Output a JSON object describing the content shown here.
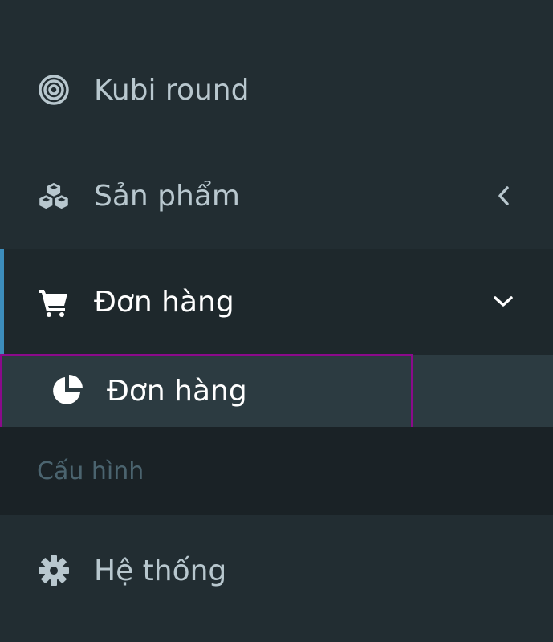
{
  "sidebar": {
    "items": [
      {
        "label": "Kubi round",
        "icon": "bullseye-icon"
      },
      {
        "label": "Sản phẩm",
        "icon": "cubes-icon",
        "chevron": "chevron-left-icon"
      },
      {
        "label": "Đơn hàng",
        "icon": "shopping-cart-icon",
        "chevron": "chevron-down-icon",
        "active": true
      }
    ],
    "submenu": [
      {
        "label": "Đơn hàng",
        "icon": "pie-chart-icon"
      }
    ],
    "header": {
      "label": "Cấu hình"
    },
    "items_after": [
      {
        "label": "Hệ thống",
        "icon": "gear-icon"
      }
    ]
  },
  "colors": {
    "background": "#222d32",
    "active_background": "#1e282c",
    "active_border": "#3c8dbc",
    "submenu_background": "#2c3b41",
    "header_background": "#1a2226",
    "text": "#b8c7ce",
    "header_text": "#4b646f",
    "highlight_border": "#8b0a8b"
  }
}
